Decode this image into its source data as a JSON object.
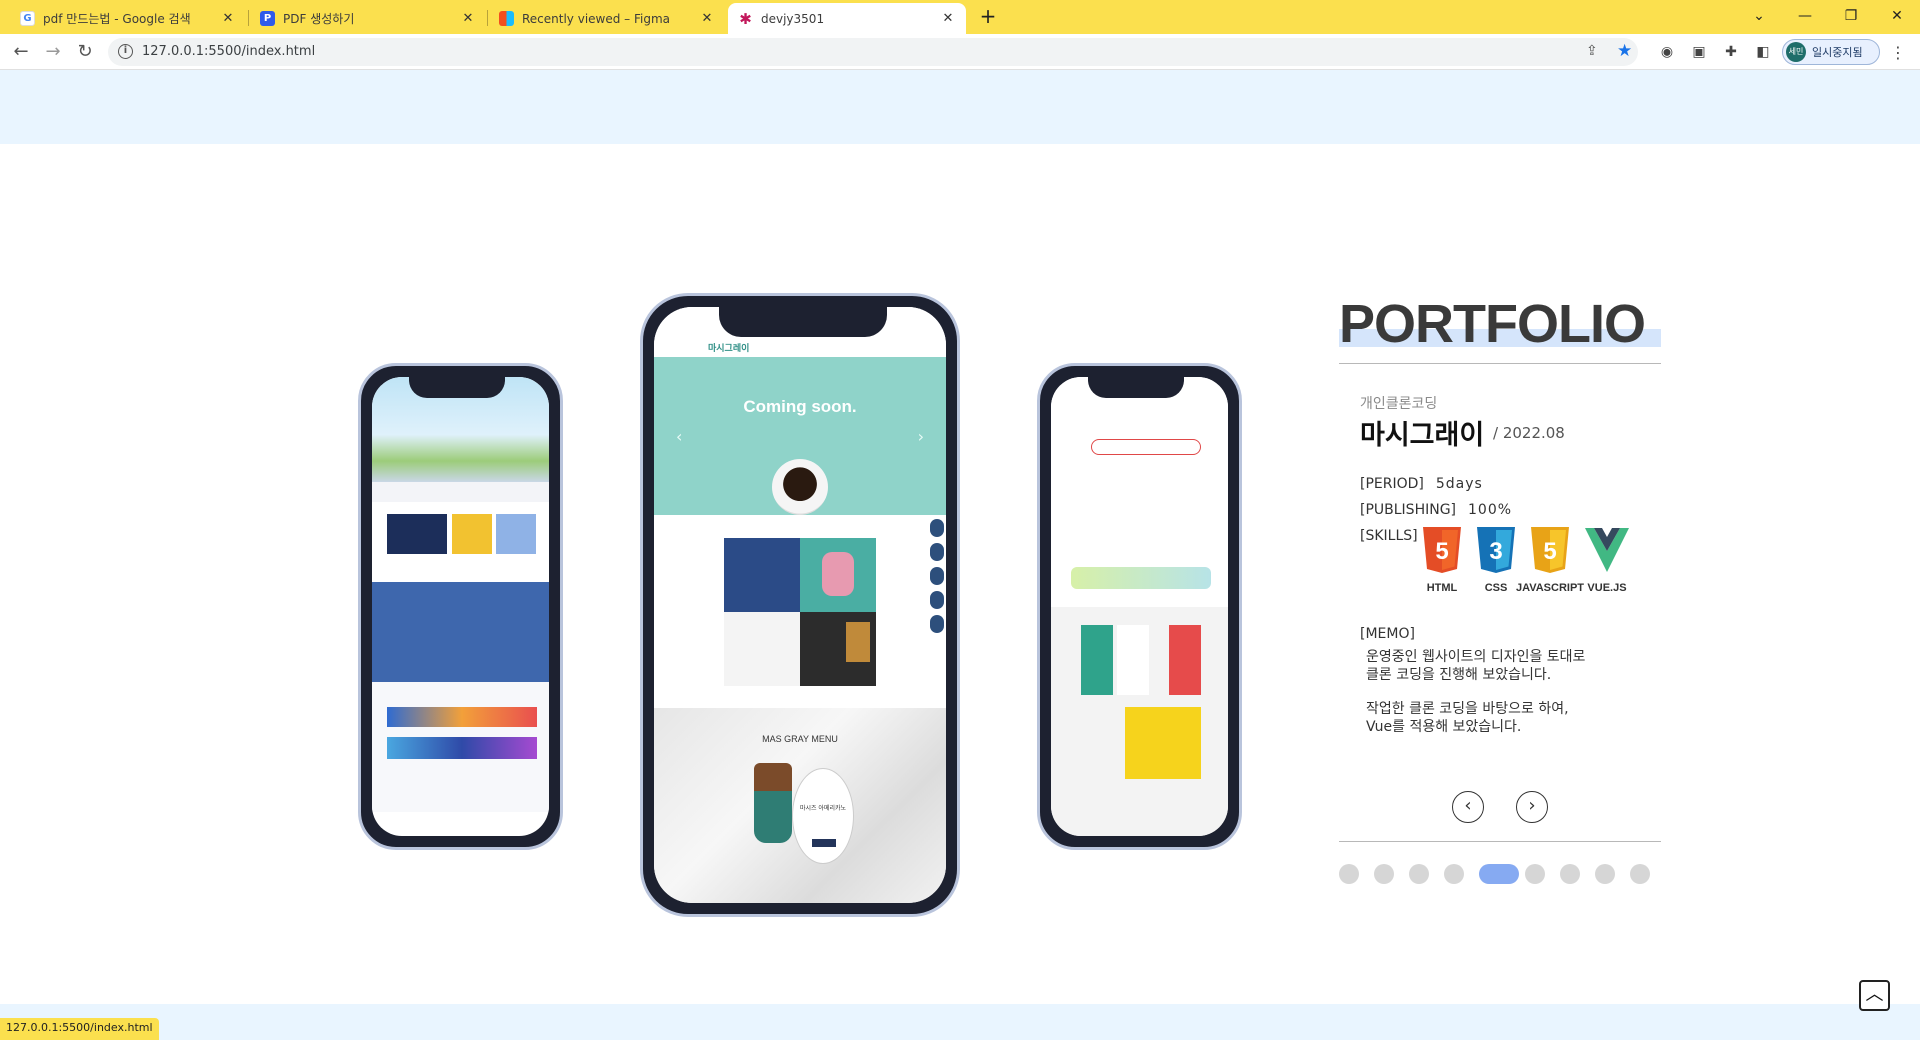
{
  "browser": {
    "tabs": [
      {
        "title": "pdf 만드는법 - Google 검색",
        "icon": "google-icon"
      },
      {
        "title": "PDF 생성하기",
        "icon": "pdf-doc-icon"
      },
      {
        "title": "Recently viewed – Figma",
        "icon": "figma-icon"
      },
      {
        "title": "devjy3501",
        "icon": "asterisk-icon"
      }
    ],
    "url": "127.0.0.1:5500/index.html",
    "profile_avatar": "세민",
    "profile_label": "일시중지됨",
    "status_url": "127.0.0.1:5500/index.html"
  },
  "slider": {
    "center_screen": {
      "logo": "마시그레이",
      "headline": "Coming soon.",
      "section_title": "MAS GRAY MENU",
      "promo_text": "마시즈 아메리카노"
    }
  },
  "portfolio": {
    "heading": "PORTFOLIO",
    "category": "개인클론코딩",
    "title": "마시그래이",
    "date": "/ 2022.08",
    "period_label": "[PERIOD]",
    "period_value": "5days",
    "publishing_label": "[PUBLISHING]",
    "publishing_value": "100%",
    "skills_label": "[SKILLS]",
    "skills": [
      {
        "name": "HTML",
        "badge": "5",
        "color": "#e44d26"
      },
      {
        "name": "CSS",
        "badge": "3",
        "color": "#1572b6"
      },
      {
        "name": "JAVASCRIPT",
        "badge": "5",
        "color": "#f0a020"
      },
      {
        "name": "VUE.JS",
        "badge": "V",
        "color": "#41b883"
      }
    ],
    "memo_label": "[MEMO]",
    "memo_lines": [
      "운영중인 웹사이트의 디자인을 토대로",
      "클론 코딩을 진행해 보았습니다.",
      "작업한 클론 코딩을 바탕으로 하여,",
      "Vue를 적용해 보았습니다."
    ],
    "pagination_count": 9,
    "pagination_active": 5
  },
  "colors": {
    "tabstrip": "#fbe04e",
    "header_band": "#e9f5ff",
    "accent_dot": "#86aaf2",
    "teal": "#8fd3c9"
  }
}
